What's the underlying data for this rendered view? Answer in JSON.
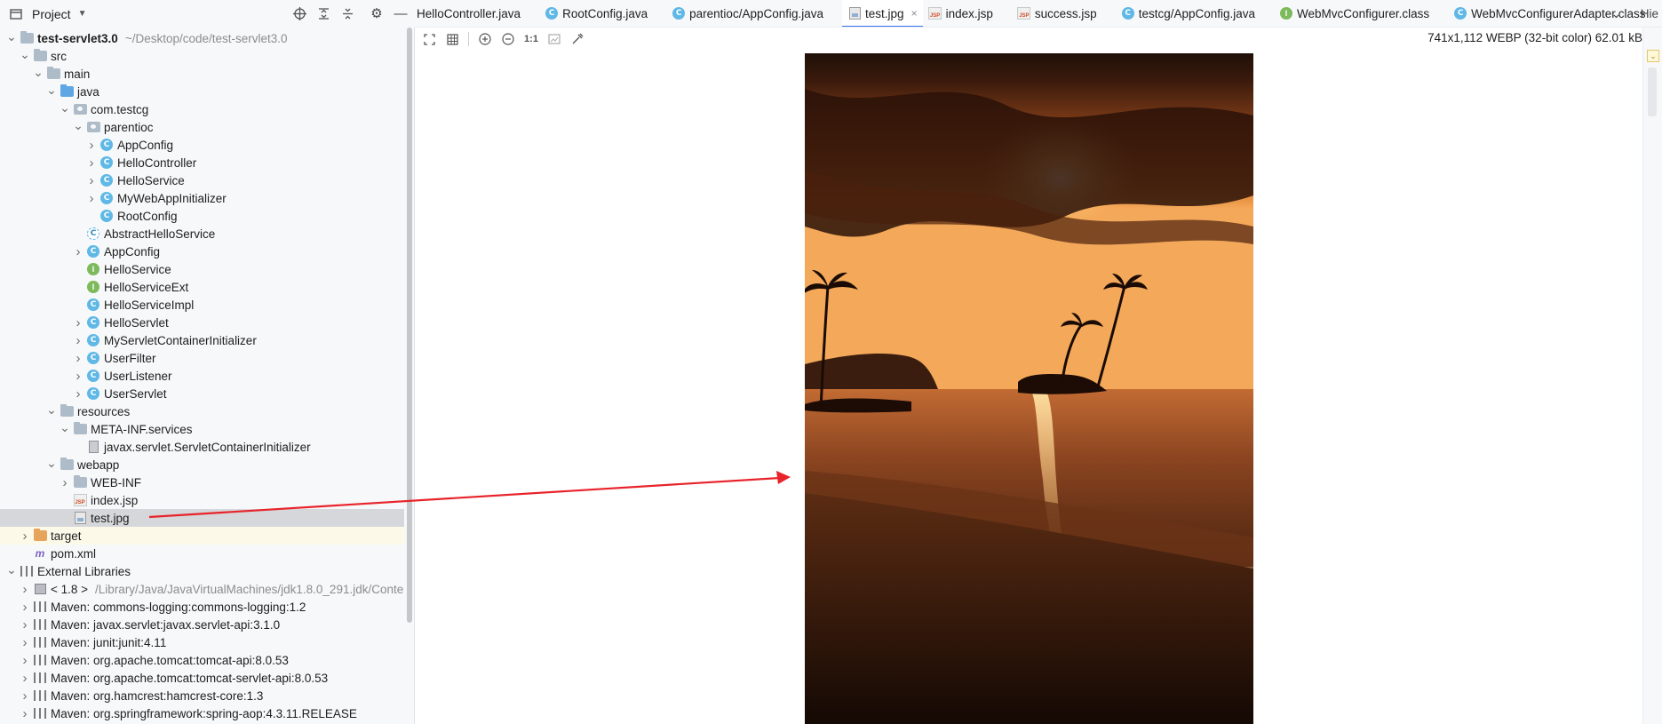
{
  "project_panel": {
    "title": "Project",
    "tools": [
      "locate-icon",
      "expand-all-icon",
      "collapse-all-icon",
      "gear-icon",
      "minimize-icon"
    ]
  },
  "tree": [
    {
      "label": "test-servlet3.0",
      "hint": "~/Desktop/code/test-servlet3.0",
      "icon": "folder-icon",
      "depth": 0,
      "expanded": true,
      "bold": true
    },
    {
      "label": "src",
      "icon": "folder-icon",
      "depth": 1,
      "expanded": true
    },
    {
      "label": "main",
      "icon": "folder-icon",
      "depth": 2,
      "expanded": true
    },
    {
      "label": "java",
      "icon": "source-folder-icon",
      "depth": 3,
      "expanded": true
    },
    {
      "label": "com.testcg",
      "icon": "package-icon",
      "depth": 4,
      "expanded": true
    },
    {
      "label": "parentioc",
      "icon": "package-icon",
      "depth": 5,
      "expanded": true
    },
    {
      "label": "AppConfig",
      "icon": "class-icon",
      "depth": 6,
      "expanded": false
    },
    {
      "label": "HelloController",
      "icon": "class-icon",
      "depth": 6,
      "expanded": false
    },
    {
      "label": "HelloService",
      "icon": "class-icon",
      "depth": 6,
      "expanded": false
    },
    {
      "label": "MyWebAppInitializer",
      "icon": "class-icon",
      "depth": 6,
      "expanded": false
    },
    {
      "label": "RootConfig",
      "icon": "class-icon",
      "depth": 6,
      "expanded": null
    },
    {
      "label": "AbstractHelloService",
      "icon": "abstract-class-icon",
      "depth": 5,
      "expanded": null
    },
    {
      "label": "AppConfig",
      "icon": "class-icon",
      "depth": 5,
      "expanded": false
    },
    {
      "label": "HelloService",
      "icon": "interface-icon",
      "depth": 5,
      "expanded": null
    },
    {
      "label": "HelloServiceExt",
      "icon": "interface-icon",
      "depth": 5,
      "expanded": null
    },
    {
      "label": "HelloServiceImpl",
      "icon": "class-icon",
      "depth": 5,
      "expanded": null
    },
    {
      "label": "HelloServlet",
      "icon": "class-icon",
      "depth": 5,
      "expanded": false
    },
    {
      "label": "MyServletContainerInitializer",
      "icon": "class-icon",
      "depth": 5,
      "expanded": false
    },
    {
      "label": "UserFilter",
      "icon": "class-icon",
      "depth": 5,
      "expanded": false
    },
    {
      "label": "UserListener",
      "icon": "class-icon",
      "depth": 5,
      "expanded": false
    },
    {
      "label": "UserServlet",
      "icon": "class-icon",
      "depth": 5,
      "expanded": false
    },
    {
      "label": "resources",
      "icon": "resources-folder-icon",
      "depth": 3,
      "expanded": true
    },
    {
      "label": "META-INF.services",
      "icon": "folder-icon",
      "depth": 4,
      "expanded": true
    },
    {
      "label": "javax.servlet.ServletContainerInitializer",
      "icon": "file-icon",
      "depth": 5,
      "expanded": null
    },
    {
      "label": "webapp",
      "icon": "folder-icon",
      "depth": 3,
      "expanded": true
    },
    {
      "label": "WEB-INF",
      "icon": "folder-icon",
      "depth": 4,
      "expanded": false
    },
    {
      "label": "index.jsp",
      "icon": "jsp-icon",
      "depth": 4,
      "expanded": null
    },
    {
      "label": "test.jpg",
      "icon": "image-file-icon",
      "depth": 4,
      "expanded": null,
      "selected": true
    },
    {
      "label": "target",
      "icon": "excluded-folder-icon",
      "depth": 1,
      "expanded": false,
      "highlighted": true
    },
    {
      "label": "pom.xml",
      "icon": "maven-icon",
      "depth": 1,
      "expanded": null
    },
    {
      "label": "External Libraries",
      "icon": "library-icon",
      "depth": 0,
      "expanded": true
    },
    {
      "label": "< 1.8 >",
      "hint": "/Library/Java/JavaVirtualMachines/jdk1.8.0_291.jdk/Conte",
      "icon": "jdk-icon",
      "depth": 1,
      "expanded": false
    },
    {
      "label": "Maven: commons-logging:commons-logging:1.2",
      "icon": "library-icon",
      "depth": 1,
      "expanded": false
    },
    {
      "label": "Maven: javax.servlet:javax.servlet-api:3.1.0",
      "icon": "library-icon",
      "depth": 1,
      "expanded": false
    },
    {
      "label": "Maven: junit:junit:4.11",
      "icon": "library-icon",
      "depth": 1,
      "expanded": false
    },
    {
      "label": "Maven: org.apache.tomcat:tomcat-api:8.0.53",
      "icon": "library-icon",
      "depth": 1,
      "expanded": false
    },
    {
      "label": "Maven: org.apache.tomcat:tomcat-servlet-api:8.0.53",
      "icon": "library-icon",
      "depth": 1,
      "expanded": false
    },
    {
      "label": "Maven: org.hamcrest:hamcrest-core:1.3",
      "icon": "library-icon",
      "depth": 1,
      "expanded": false
    },
    {
      "label": "Maven: org.springframework:spring-aop:4.3.11.RELEASE",
      "icon": "library-icon",
      "depth": 1,
      "expanded": false
    }
  ],
  "tabs": [
    {
      "label": "HelloController.java",
      "icon": "class-icon",
      "active": false,
      "closable": false
    },
    {
      "label": "RootConfig.java",
      "icon": "class-icon",
      "active": false,
      "closable": false
    },
    {
      "label": "parentioc/AppConfig.java",
      "icon": "class-icon",
      "active": false,
      "closable": false
    },
    {
      "label": "test.jpg",
      "icon": "image-file-icon",
      "active": true,
      "closable": true
    },
    {
      "label": "index.jsp",
      "icon": "jsp-icon",
      "active": false,
      "closable": false
    },
    {
      "label": "success.jsp",
      "icon": "jsp-icon",
      "active": false,
      "closable": false
    },
    {
      "label": "testcg/AppConfig.java",
      "icon": "class-icon",
      "active": false,
      "closable": false
    },
    {
      "label": "WebMvcConfigurer.class",
      "icon": "interface-icon",
      "active": false,
      "closable": false
    },
    {
      "label": "WebMvcConfigurerAdapter.class",
      "icon": "class-icon",
      "active": false,
      "closable": false
    }
  ],
  "tab_overflow_label": "Hie",
  "viewer": {
    "tools": [
      "fit-to-window-icon",
      "grid-icon",
      "zoom-in-icon",
      "zoom-out-icon",
      "actual-size-icon",
      "background-icon",
      "color-picker-icon"
    ],
    "actual_size_label": "1:1",
    "image_info": "741x1,112 WEBP (32-bit color) 62.01 kB",
    "image_alt": "Sunset over the ocean with palm trees on a small island",
    "annotation_arrow": true
  },
  "colors": {
    "accent": "#3574f0",
    "selection": "#d5d7db",
    "annotation_arrow": "#e8232a"
  }
}
